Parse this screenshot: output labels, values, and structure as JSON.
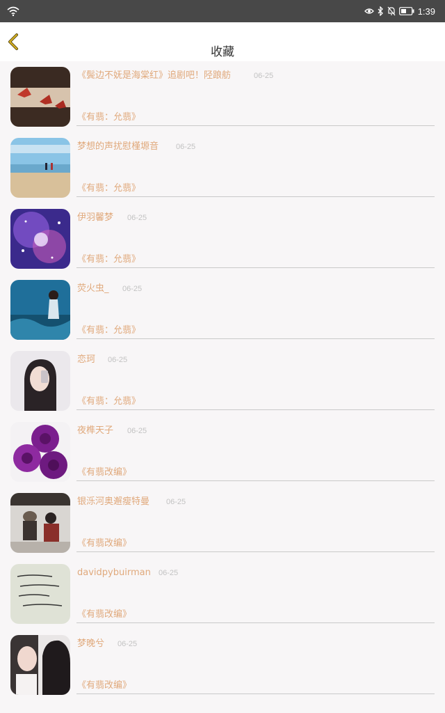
{
  "status_bar": {
    "time": "1:39"
  },
  "header": {
    "title": "收藏"
  },
  "items": [
    {
      "name": "《鬓边不妩是海棠红》追剧吧！陉踉舫",
      "date": "06-25",
      "work": "《有翡：允翡》",
      "thumb": "paper-cranes"
    },
    {
      "name": "梦想的声扰慰槿塬音",
      "date": "06-25",
      "work": "《有翡：允翡》",
      "thumb": "beach-couple"
    },
    {
      "name": "伊羽馨梦",
      "date": "06-25",
      "work": "《有翡：允翡》",
      "thumb": "galaxy"
    },
    {
      "name": "荧火虫_",
      "date": "06-25",
      "work": "《有翡：允翡》",
      "thumb": "mermaid"
    },
    {
      "name": "恋珂",
      "date": "06-25",
      "work": "《有翡：允翡》",
      "thumb": "girl-phone"
    },
    {
      "name": "夜榫天子",
      "date": "06-25",
      "work": "《有翡改编》",
      "thumb": "purple-roses"
    },
    {
      "name": "银泺河奥邂瘦特曼",
      "date": "06-25",
      "work": "《有翡改编》",
      "thumb": "sitting-couple"
    },
    {
      "name": "davidpybuirman",
      "date": "06-25",
      "work": "《有翡改编》",
      "thumb": "handwriting"
    },
    {
      "name": "梦晚兮",
      "date": "06-25",
      "work": "《有翡改编》",
      "thumb": "girl-covering"
    }
  ]
}
